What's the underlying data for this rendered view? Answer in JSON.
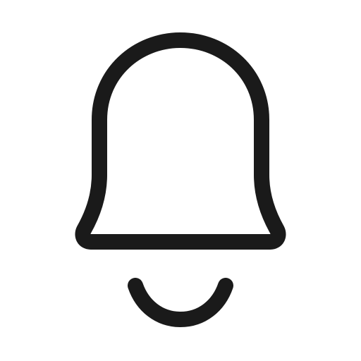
{
  "icon": {
    "name": "bell-icon",
    "stroke_color": "#1a1a1a",
    "background_color": "#ffffff"
  }
}
